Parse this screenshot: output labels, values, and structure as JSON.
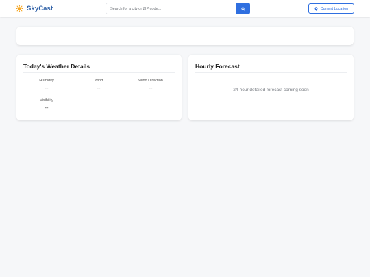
{
  "app": {
    "name": "SkyCast",
    "logo_icon": "sun-icon",
    "accent_color": "#2f6fe0",
    "brand_color": "#2d5fa6",
    "logo_icon_color": "#f5a623"
  },
  "header": {
    "search": {
      "placeholder": "Search for a city or ZIP code...",
      "value": "",
      "button_icon": "search-icon"
    },
    "current_location": {
      "label": "Current Location",
      "icon": "map-pin-icon"
    }
  },
  "details": {
    "title": "Today's Weather Details",
    "items": [
      {
        "label": "Humidity",
        "value": "--"
      },
      {
        "label": "Wind",
        "value": "--"
      },
      {
        "label": "Wind Direction",
        "value": "--"
      },
      {
        "label": "Visibility",
        "value": "--"
      }
    ]
  },
  "forecast": {
    "title": "Hourly Forecast",
    "message": "24-hour detailed forecast coming soon"
  }
}
